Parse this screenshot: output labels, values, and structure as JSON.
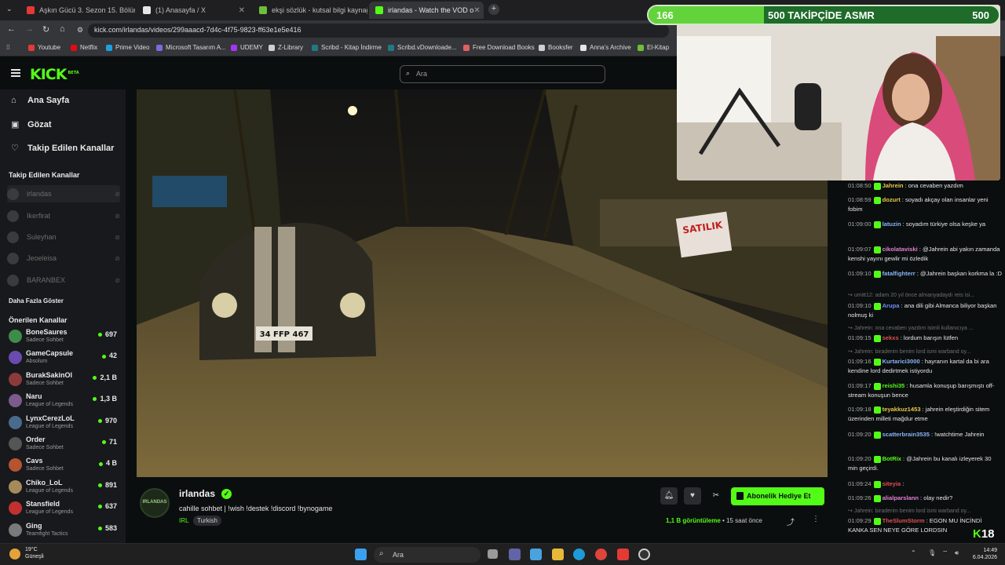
{
  "browser": {
    "tabs": [
      {
        "label": "Aşkın Gücü 3. Sezon 15. Bölüm",
        "color": "#e53935"
      },
      {
        "label": "(1) Anasayfa / X",
        "color": "#e6e6e6"
      },
      {
        "label": "ekşi sözlük - kutsal bilgi kaynağ",
        "color": "#6bbf3a"
      },
      {
        "label": "irlandas - Watch the VOD o",
        "color": "#53fc18"
      }
    ],
    "url": "kick.com/irlandas/videos/299aaacd-7d4c-4f75-9823-ff63e1e5e416",
    "bookmarks": [
      "Youtube",
      "Netflix",
      "Prime Video",
      "Microsoft Tasarım A...",
      "UDEMY",
      "Z-Library",
      "Scribd - Kitap İndirme",
      "Scribd.vDownloade...",
      "Free Download Books",
      "Booksfer",
      "Anna's Archive",
      "El-Kitap"
    ]
  },
  "header": {
    "logo": "KICK",
    "logo_sup": "BETA",
    "search_placeholder": "Ara"
  },
  "sidebar": {
    "nav": [
      {
        "label": "Ana Sayfa",
        "icon": "home-icon",
        "glyph": "⌂"
      },
      {
        "label": "Gözat",
        "icon": "browse-icon",
        "glyph": "▣"
      },
      {
        "label": "Takip Edilen Kanallar",
        "icon": "heart-icon",
        "glyph": "♡"
      }
    ],
    "followed_title": "Takip Edilen Kanallar",
    "followed": [
      "irlandas",
      "Ikerfirat",
      "Suleyhan",
      "Jeoeleisa",
      "BARANBEX"
    ],
    "show_more": "Daha Fazla Göster",
    "recommended_title": "Önerilen Kanallar",
    "recommended": [
      {
        "name": "BoneSaures",
        "category": "Sadece Sohbet",
        "viewers": "697",
        "color": "#3d8c4a"
      },
      {
        "name": "GameCapsule",
        "category": "Absolum",
        "viewers": "42",
        "color": "#6a4bb0"
      },
      {
        "name": "BurakSakinOl",
        "category": "Sadece Sohbet",
        "viewers": "2,1 B",
        "color": "#8c3b3b"
      },
      {
        "name": "Naru",
        "category": "League of Legends",
        "viewers": "1,3 B",
        "color": "#7b5a8c"
      },
      {
        "name": "LynxCerezLoL",
        "category": "League of Legends",
        "viewers": "970",
        "color": "#4a6a8c"
      },
      {
        "name": "Order",
        "category": "Sadece Sohbet",
        "viewers": "71",
        "color": "#555555"
      },
      {
        "name": "Cavs",
        "category": "Sadece Sohbet",
        "viewers": "4 B",
        "color": "#b5542f"
      },
      {
        "name": "Chiko_LoL",
        "category": "League of Legends",
        "viewers": "891",
        "color": "#a58a5a"
      },
      {
        "name": "Stansfield",
        "category": "League of Legends",
        "viewers": "637",
        "color": "#c23030"
      },
      {
        "name": "Ging",
        "category": "Teamfight Tactics",
        "viewers": "583",
        "color": "#7a7a7a"
      }
    ]
  },
  "stream": {
    "channel": "irlandas",
    "avatar_text": "IRLANDAS",
    "title": "cahille sohbet | !wish !destek !discord !bynogame",
    "category": "IRL",
    "tag": "Turkish",
    "views": "1,1 B görüntüleme",
    "time_ago": "15 saat önce",
    "subscribe_label": "Abonelik Hediye Et",
    "sign_text": "SATILIK",
    "plate": "34 FFP 467"
  },
  "goal": {
    "current": "166",
    "label": "500 TAKİPÇİDE ASMR",
    "target": "500",
    "progress": 0.33
  },
  "chat": [
    {
      "type": "msg",
      "time": "01:08:50",
      "user": "Jahrein",
      "color": "#e6c84a",
      "text": ": ona cevaben yazdım"
    },
    {
      "type": "msg",
      "time": "01:08:59",
      "user": "dozurt",
      "color": "#e6c84a",
      "text": ": soyadı akçay olan insanlar yeni fobim"
    },
    {
      "type": "msg",
      "time": "01:09:00",
      "user": "latuzin",
      "color": "#8ab4f8",
      "text": ": soyadım türkiye olsa keşke ya"
    },
    {
      "type": "msg",
      "time": "01:09:07",
      "user": "cikolataviski",
      "color": "#e080d0",
      "text": ": @Jahrein abi yakın zamanda kenshi yayını gewlir mi özledik"
    },
    {
      "type": "msg",
      "time": "01:09:10",
      "user": "fatalfighterr",
      "color": "#8ab4f8",
      "text": ": @Jahrein başkan korkma la :D"
    },
    {
      "type": "sys",
      "text": "umitt12: adam 20 yıl önce almanyadaydı reis isi..."
    },
    {
      "type": "msg",
      "time": "01:09:10",
      "user": "Arupa",
      "color": "#6e8cf8",
      "text": ": ana dili gibi Almanca biliyor başkan nolmuş ki"
    },
    {
      "type": "sys",
      "text": "Jahrein: ona cevaben yazdım isimli kullanıcıya ..."
    },
    {
      "type": "msg",
      "time": "01:09:15",
      "user": "sekxs",
      "color": "#e05050",
      "text": ": lordum barışın lütfen"
    },
    {
      "type": "sys",
      "text": "Jahrein: biraderim benim lord ismi warband oy..."
    },
    {
      "type": "msg",
      "time": "01:09:16",
      "user": "Kurtarici3000",
      "color": "#8ab4f8",
      "text": ": hayranın kartal da bi ara kendine lord dedirtmek istiyordu"
    },
    {
      "type": "msg",
      "time": "01:09:17",
      "user": "reishi35",
      "color": "#53fc18",
      "text": ": husamla konuşup barışmıştı off-stream konuşun bence"
    },
    {
      "type": "msg",
      "time": "01:09:18",
      "user": "teyakkuz1453",
      "color": "#e6c84a",
      "text": ": jahrein eleştirdiğin sitem üzerinden milleti mağdur etme"
    },
    {
      "type": "msg",
      "time": "01:09:20",
      "user": "scatterbrain3535",
      "color": "#8ab4f8",
      "text": ": !watchtime Jahrein"
    },
    {
      "type": "msg",
      "time": "01:09:20",
      "user": "BotRix",
      "color": "#53fc18",
      "text": ": @Jahrein bu kanalı izleyerek 30 min geçirdi."
    },
    {
      "type": "msg",
      "time": "01:09:24",
      "user": "siteyia",
      "color": "#e05050",
      "text": ":"
    },
    {
      "type": "msg",
      "time": "01:09:26",
      "user": "alialparslann",
      "color": "#e080d0",
      "text": ": olay nedir?"
    },
    {
      "type": "sys",
      "text": "Jahrein: biraderim benim lord ismi warband oy..."
    },
    {
      "type": "msg",
      "time": "01:09:29",
      "user": "TheSlumStorm",
      "color": "#e05050",
      "text": ": EGON MU İNCİNDİ KANKA SEN NEYE GÖRE LORDSIN"
    }
  ],
  "rating": "18",
  "taskbar": {
    "weather_temp": "19°C",
    "weather_desc": "Güneşli",
    "search_label": "Ara",
    "time": "14:49",
    "date": "6.04.2026"
  }
}
